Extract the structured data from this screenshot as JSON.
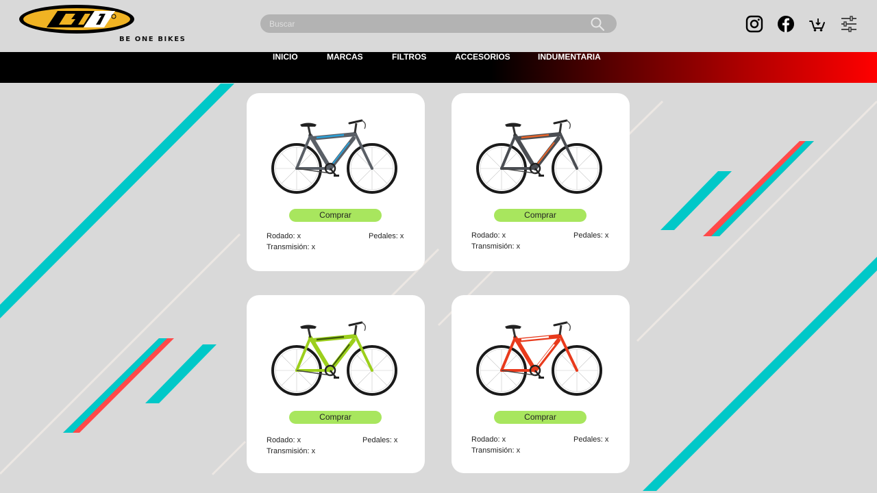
{
  "brand": {
    "logo_text": "BE ONE BIKES",
    "colors": {
      "yellow": "#f0b323",
      "black": "#000000",
      "accent_green": "#a8e65e",
      "nav_red": "#ff0000",
      "stripe_cyan": "#00c8c8",
      "stripe_red": "#ff4a4a"
    }
  },
  "search": {
    "placeholder": "Buscar",
    "value": ""
  },
  "header_icons": [
    "instagram-icon",
    "facebook-icon",
    "cart-icon",
    "filter-sliders-icon"
  ],
  "nav": {
    "items": [
      {
        "label": "INICIO"
      },
      {
        "label": "MARCAS"
      },
      {
        "label": "FILTROS"
      },
      {
        "label": "ACCESORIOS"
      },
      {
        "label": "INDUMENTARIA"
      }
    ]
  },
  "products": [
    {
      "frame_color": "#5a5f66",
      "accent_color": "#2aa0d8",
      "button": "Comprar",
      "rodado": "Rodado: x",
      "pedales": "Pedales: x",
      "transmision": "Transmisión: x"
    },
    {
      "frame_color": "#4a4d52",
      "accent_color": "#e8652a",
      "button": "Comprar",
      "rodado": "Rodado: x",
      "pedales": "Pedales: x",
      "transmision": "Transmisión: x"
    },
    {
      "frame_color": "#9ccf1c",
      "accent_color": "#3d5a0a",
      "button": "Comprar",
      "rodado": "Rodado: x",
      "pedales": "Pedales: x",
      "transmision": "Transmisión: x"
    },
    {
      "frame_color": "#e83a1c",
      "accent_color": "#ffffff",
      "button": "Comprar",
      "rodado": "Rodado: x",
      "pedales": "Pedales: x",
      "transmision": "Transmisión: x"
    }
  ]
}
